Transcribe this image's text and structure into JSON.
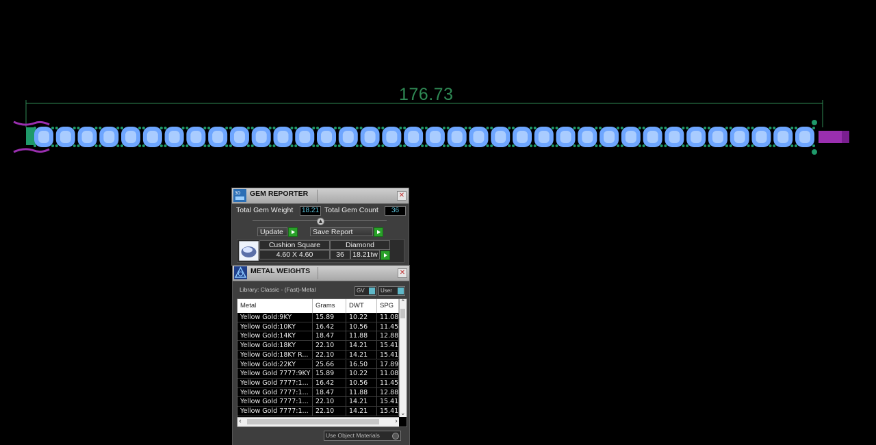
{
  "viewport": {
    "dimension_label": "176.73",
    "gem_count_rendered": 36,
    "colors": {
      "gem": "#6ea6ff",
      "setting": "#1f9a6a",
      "dimension": "#2f8a55",
      "clasp": "#9a2fb0"
    }
  },
  "gem_reporter": {
    "title": "GEM REPORTER",
    "total_weight_label": "Total Gem Weight",
    "total_weight_value": "18.21",
    "total_count_label": "Total Gem Count",
    "total_count_value": "36",
    "update_label": "Update",
    "save_label": "Save Report",
    "gem": {
      "shape": "Cushion Square",
      "material": "Diamond",
      "size": "4.60 X 4.60",
      "count": "36",
      "weight": "18.21tw"
    }
  },
  "metal_weights": {
    "title": "METAL WEIGHTS",
    "library_label": "Library: Classic - (Fast)-Metal",
    "gv_label": "GV",
    "user_label": "User",
    "columns": [
      "Metal",
      "Grams",
      "DWT",
      "SPG"
    ],
    "rows": [
      [
        "Yellow Gold:9KY",
        "15.89",
        "10.22",
        "11.08"
      ],
      [
        "Yellow Gold:10KY",
        "16.42",
        "10.56",
        "11.45"
      ],
      [
        "Yellow Gold:14KY",
        "18.47",
        "11.88",
        "12.88"
      ],
      [
        "Yellow Gold:18KY",
        "22.10",
        "14.21",
        "15.41"
      ],
      [
        "Yellow Gold:18KY R...",
        "22.10",
        "14.21",
        "15.41"
      ],
      [
        "Yellow Gold:22KY",
        "25.66",
        "16.50",
        "17.89"
      ],
      [
        "Yellow Gold 7777:9KY",
        "15.89",
        "10.22",
        "11.08"
      ],
      [
        "Yellow Gold 7777:1...",
        "16.42",
        "10.56",
        "11.45"
      ],
      [
        "Yellow Gold 7777:1...",
        "18.47",
        "11.88",
        "12.88"
      ],
      [
        "Yellow Gold 7777:1...",
        "22.10",
        "14.21",
        "15.41"
      ],
      [
        "Yellow Gold 7777:1...",
        "22.10",
        "14.21",
        "15.41"
      ]
    ],
    "use_object_materials_label": "Use Object Materials"
  }
}
